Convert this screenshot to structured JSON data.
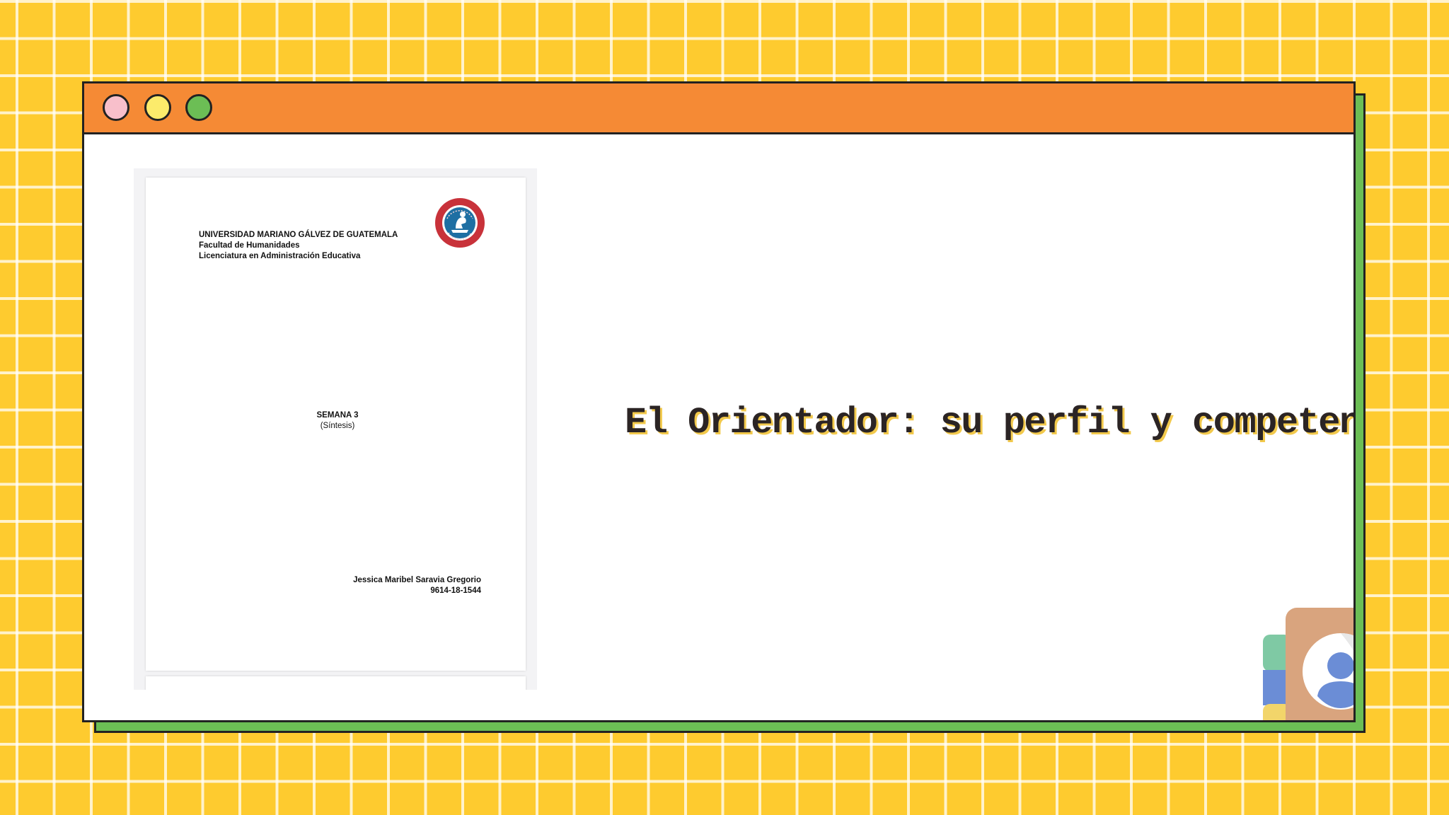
{
  "window": {
    "controls": [
      "close",
      "minimize",
      "maximize"
    ]
  },
  "document": {
    "university": "UNIVERSIDAD MARIANO GÁLVEZ DE GUATEMALA",
    "faculty": "Facultad de Humanidades",
    "program": "Licenciatura en Administración Educativa",
    "week": "SEMANA 3",
    "subtitle": "(Síntesis)",
    "author": "Jessica Maribel Saravia Gregorio",
    "student_id": "9614-18-1544"
  },
  "slide": {
    "title": "El Orientador: su perfil y competencia"
  },
  "icons": {
    "seal": "university-seal-icon",
    "contact": "contact-book-icon"
  },
  "colors": {
    "background": "#FECB2F",
    "titlebar": "#F58A35",
    "shadow": "#6CBE55",
    "dot_pink": "#F8BFCB",
    "dot_yellow": "#FCEB6B",
    "dot_green": "#6CBE55"
  }
}
